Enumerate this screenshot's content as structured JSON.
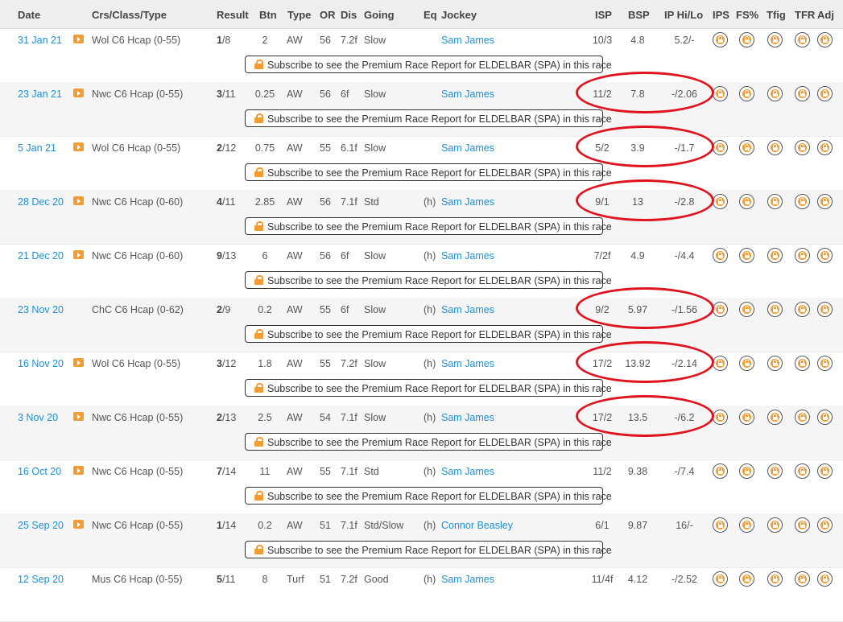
{
  "columns": {
    "date": "Date",
    "crs": "Crs/Class/Type",
    "result": "Result",
    "btn": "Btn",
    "type": "Type",
    "or": "OR",
    "dis": "Dis",
    "going": "Going",
    "eq": "Eq",
    "jockey": "Jockey",
    "isp": "ISP",
    "bsp": "BSP",
    "ip": "IP Hi/Lo",
    "ips": "IPS",
    "fs": "FS%",
    "tfig": "Tfig",
    "tfr": "TFR",
    "adj": "Adj"
  },
  "subscribe_text": "Subscribe to see the Premium Race Report for ELDELBAR (SPA) in this race",
  "rows": [
    {
      "date": "31 Jan 21",
      "video": true,
      "crs": "Wol C6 Hcap (0-55)",
      "pos": "1",
      "runners": "/8",
      "btn": "2",
      "type": "AW",
      "or": "56",
      "dis": "7.2f",
      "going": "Slow",
      "eq": "",
      "jockey": "Sam James",
      "isp": "10/3",
      "bsp": "4.8",
      "ip": "5.2/-",
      "highlighted": false
    },
    {
      "date": "23 Jan 21",
      "video": true,
      "crs": "Nwc C6 Hcap (0-55)",
      "pos": "3",
      "runners": "/11",
      "btn": "0.25",
      "type": "AW",
      "or": "56",
      "dis": "6f",
      "going": "Slow",
      "eq": "",
      "jockey": "Sam James",
      "isp": "11/2",
      "bsp": "7.8",
      "ip": "-/2.06",
      "highlighted": true
    },
    {
      "date": "5 Jan 21",
      "video": true,
      "crs": "Wol C6 Hcap (0-55)",
      "pos": "2",
      "runners": "/12",
      "btn": "0.75",
      "type": "AW",
      "or": "55",
      "dis": "6.1f",
      "going": "Slow",
      "eq": "",
      "jockey": "Sam James",
      "isp": "5/2",
      "bsp": "3.9",
      "ip": "-/1.7",
      "highlighted": true
    },
    {
      "date": "28 Dec 20",
      "video": true,
      "crs": "Nwc C6 Hcap (0-60)",
      "pos": "4",
      "runners": "/11",
      "btn": "2.85",
      "type": "AW",
      "or": "56",
      "dis": "7.1f",
      "going": "Std",
      "eq": "(h)",
      "jockey": "Sam James",
      "isp": "9/1",
      "bsp": "13",
      "ip": "-/2.8",
      "highlighted": true
    },
    {
      "date": "21 Dec 20",
      "video": true,
      "crs": "Nwc C6 Hcap (0-60)",
      "pos": "9",
      "runners": "/13",
      "btn": "6",
      "type": "AW",
      "or": "56",
      "dis": "6f",
      "going": "Slow",
      "eq": "(h)",
      "jockey": "Sam James",
      "isp": "7/2f",
      "bsp": "4.9",
      "ip": "-/4.4",
      "highlighted": false
    },
    {
      "date": "23 Nov 20",
      "video": false,
      "crs": "ChC C6 Hcap (0-62)",
      "pos": "2",
      "runners": "/9",
      "btn": "0.2",
      "type": "AW",
      "or": "55",
      "dis": "6f",
      "going": "Slow",
      "eq": "(h)",
      "jockey": "Sam James",
      "isp": "9/2",
      "bsp": "5.97",
      "ip": "-/1.56",
      "highlighted": true
    },
    {
      "date": "16 Nov 20",
      "video": true,
      "crs": "Wol C6 Hcap (0-55)",
      "pos": "3",
      "runners": "/12",
      "btn": "1.8",
      "type": "AW",
      "or": "55",
      "dis": "7.2f",
      "going": "Slow",
      "eq": "(h)",
      "jockey": "Sam James",
      "isp": "17/2",
      "bsp": "13.92",
      "ip": "-/2.14",
      "highlighted": true
    },
    {
      "date": "3 Nov 20",
      "video": true,
      "crs": "Nwc C6 Hcap (0-55)",
      "pos": "2",
      "runners": "/13",
      "btn": "2.5",
      "type": "AW",
      "or": "54",
      "dis": "7.1f",
      "going": "Slow",
      "eq": "(h)",
      "jockey": "Sam James",
      "isp": "17/2",
      "bsp": "13.5",
      "ip": "-/6.2",
      "highlighted": true
    },
    {
      "date": "16 Oct 20",
      "video": true,
      "crs": "Nwc C6 Hcap (0-55)",
      "pos": "7",
      "runners": "/14",
      "btn": "11",
      "type": "AW",
      "or": "55",
      "dis": "7.1f",
      "going": "Std",
      "eq": "(h)",
      "jockey": "Sam James",
      "isp": "11/2",
      "bsp": "9.38",
      "ip": "-/7.4",
      "highlighted": false
    },
    {
      "date": "25 Sep 20",
      "video": true,
      "crs": "Nwc C6 Hcap (0-55)",
      "pos": "1",
      "runners": "/14",
      "btn": "0.2",
      "type": "AW",
      "or": "51",
      "dis": "7.1f",
      "going": "Std/Slow",
      "eq": "(h)",
      "jockey": "Connor Beasley",
      "isp": "6/1",
      "bsp": "9.87",
      "ip": "16/-",
      "highlighted": false
    },
    {
      "date": "12 Sep 20",
      "video": false,
      "crs": "Mus C6 Hcap (0-55)",
      "pos": "5",
      "runners": "/11",
      "btn": "8",
      "type": "Turf",
      "or": "51",
      "dis": "7.2f",
      "going": "Good",
      "eq": "(h)",
      "jockey": "Sam James",
      "isp": "11/4f",
      "bsp": "4.12",
      "ip": "-/2.52",
      "highlighted": false
    }
  ],
  "colors": {
    "link": "#1e8fd5",
    "lock": "#f39c32",
    "highlight_oval": "#e0141e"
  },
  "icons": {
    "video": "video-play-icon",
    "lock": "lock-icon"
  }
}
